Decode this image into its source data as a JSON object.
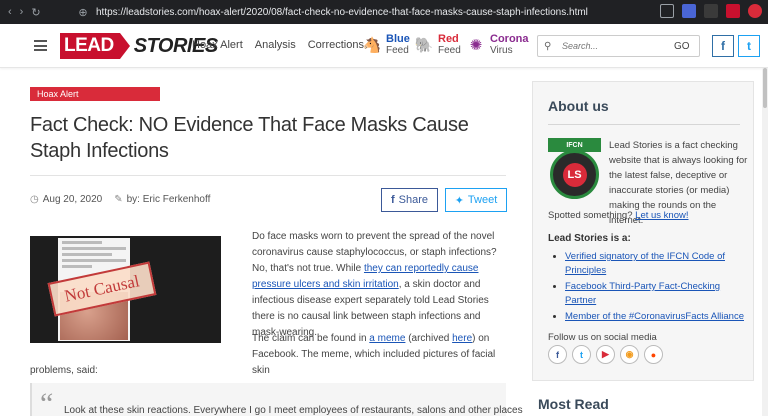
{
  "browser": {
    "url": "https://leadstories.com/hoax-alert/2020/08/fact-check-no-evidence-that-face-masks-cause-staph-infections.html"
  },
  "header": {
    "logo_lead": "LEAD",
    "logo_stories": "STORIES",
    "nav": [
      "Hoax Alert",
      "Analysis",
      "Corrections"
    ],
    "feeds": [
      {
        "title": "Blue",
        "sub": "Feed",
        "color": "#1a55b7"
      },
      {
        "title": "Red",
        "sub": "Feed",
        "color": "#d92b3a"
      },
      {
        "title": "Corona",
        "sub": "Virus",
        "color": "#8a2b8f"
      }
    ],
    "search_placeholder": "Search...",
    "search_go": "GO",
    "fb": "f",
    "tw": "t"
  },
  "article": {
    "badge": "Hoax Alert",
    "title": "Fact Check: NO Evidence That Face Masks Cause Staph Infections",
    "date": "Aug 20, 2020",
    "author": "by: Eric Ferkenhoff",
    "share": "Share",
    "tweet": "Tweet",
    "stamp": "Not Causal",
    "p1_a": "Do face masks worn to prevent the spread of the novel coronavirus cause staphylococcus, or staph infections? No, that's not true. While ",
    "p1_link": "they can reportedly cause pressure ulcers and skin irritation",
    "p1_b": ", a skin doctor and infectious disease expert separately told Lead Stories there is no causal link between staph infections and mask-wearing.",
    "p2_a": "The claim can be found in ",
    "p2_link1": "a meme",
    "p2_b": " (archived ",
    "p2_link2": "here",
    "p2_c": ") on Facebook. The meme, which included pictures of facial skin",
    "p2_d": "problems, said:",
    "quote_mark": "“",
    "quote": "Look at these skin reactions. Everywhere I go I meet employees of restaurants, salons and other places"
  },
  "sidebar": {
    "about_title": "About us",
    "ifcn_top": "IFCN",
    "ifcn_inner": "LS",
    "about_text": "Lead Stories is a fact checking website that is always looking for the latest false, deceptive or inaccurate stories (or media) making the rounds on the internet.",
    "spotted": "Spotted something? ",
    "let_us_know": "Let us know!",
    "is_a": "Lead Stories is a:",
    "is_list": [
      "Verified signatory of the IFCN Code of Principles",
      "Facebook Third-Party Fact-Checking Partner",
      "Member of the #CoronavirusFacts Alliance"
    ],
    "follow": "Follow us on social media",
    "most_read": "Most Read"
  }
}
